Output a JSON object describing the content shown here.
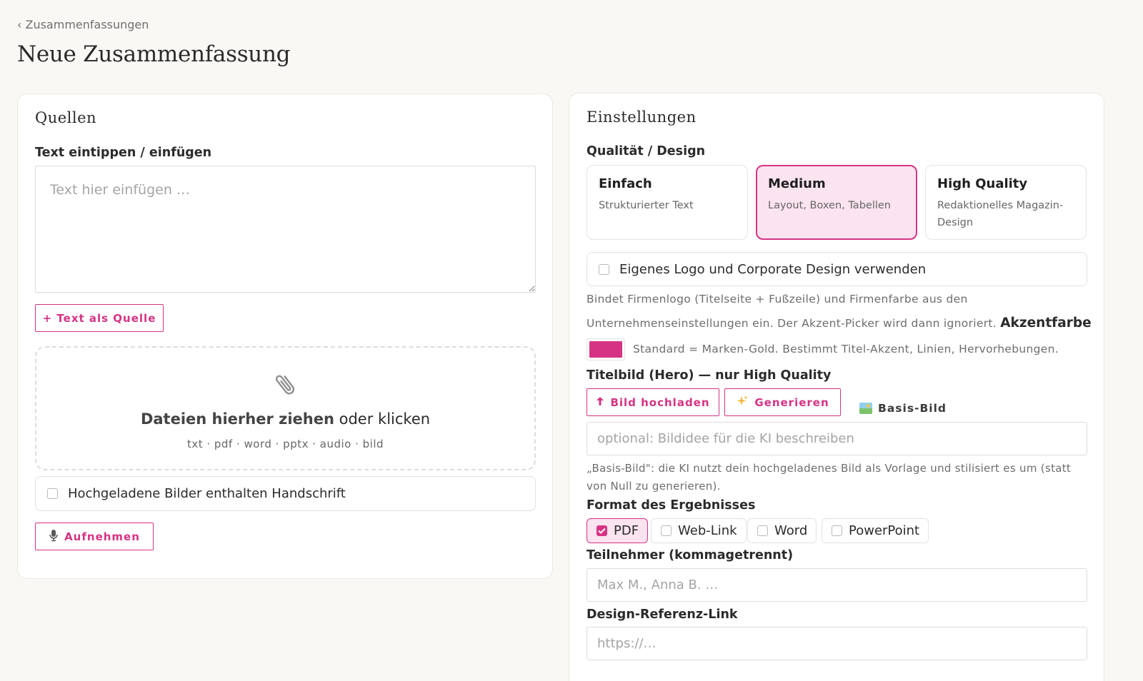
{
  "breadcrumb": "‹ Zusammenfassungen",
  "page_title": "Neue Zusammenfassung",
  "sources": {
    "title": "Quellen",
    "text_label": "Text eintippen / einfügen",
    "text_placeholder": "Text hier einfügen …",
    "add_text_button": "+ Text als Quelle",
    "dropzone": {
      "main_bold": "Dateien hierher ziehen",
      "main_rest": " oder klicken",
      "formats": "txt · pdf · word · pptx · audio · bild"
    },
    "handwriting_label": "Hochgeladene Bilder enthalten Handschrift",
    "handwriting_checked": false,
    "record_button": "Aufnehmen"
  },
  "settings": {
    "title": "Einstellungen",
    "quality_label": "Qualität / Design",
    "quality_options": [
      {
        "title": "Einfach",
        "desc": "Strukturierter Text",
        "selected": false
      },
      {
        "title": "Medium",
        "desc": "Layout, Boxen, Tabellen",
        "selected": true
      },
      {
        "title": "High Quality",
        "desc": "Redaktionelles Magazin-Design",
        "selected": false
      }
    ],
    "corporate_label": "Eigenes Logo und Corporate Design verwenden",
    "corporate_checked": false,
    "corporate_help_line1": "Bindet Firmenlogo (Titelseite + Fußzeile) und Firmenfarbe aus den",
    "corporate_help_line2": "Unternehmenseinstellungen ein. Der Akzent-Picker wird dann ignoriert.",
    "accent_label": "Akzentfarbe",
    "accent_color": "#d63384",
    "accent_help": "Standard = Marken-Gold. Bestimmt Titel-Akzent, Linien, Hervorhebungen.",
    "hero_label": "Titelbild (Hero) — nur High Quality",
    "upload_button": "Bild hochladen",
    "generate_button": "Generieren",
    "basis_button": "Basis-Bild",
    "image_prompt_placeholder": "optional: Bildidee für die KI beschreiben",
    "basis_help": "„Basis-Bild\": die KI nutzt dein hochgeladenes Bild als Vorlage und stilisiert es um (statt von Null zu generieren).",
    "format_label": "Format des Ergebnisses",
    "formats": [
      {
        "label": "PDF",
        "checked": true
      },
      {
        "label": "Web-Link",
        "checked": false
      },
      {
        "label": "Word",
        "checked": false
      },
      {
        "label": "PowerPoint",
        "checked": false
      }
    ],
    "participants_label": "Teilnehmer (kommagetrennt)",
    "participants_placeholder": "Max M., Anna B. …",
    "design_ref_label": "Design-Referenz-Link",
    "design_ref_placeholder": "https://…"
  },
  "colors": {
    "accent": "#d63384",
    "accent_soft": "#fbe3ef",
    "background": "#faf8f4"
  }
}
